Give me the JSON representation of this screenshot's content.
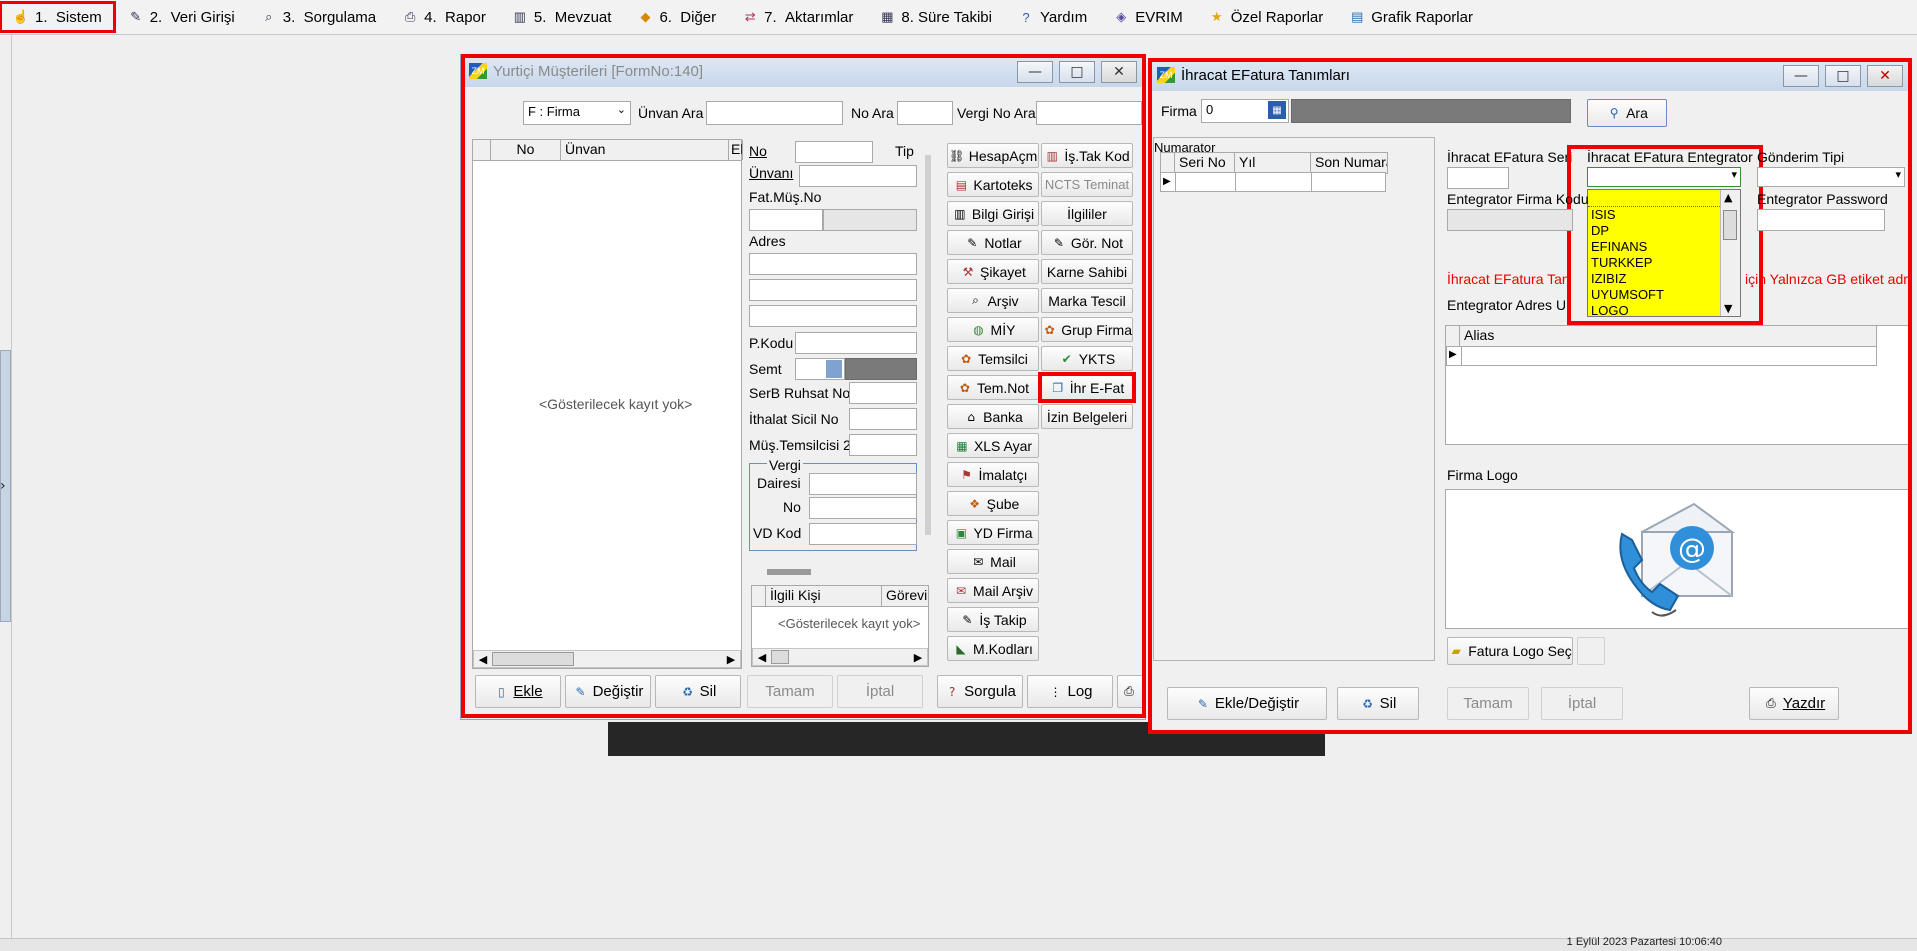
{
  "menu": [
    {
      "num": "1.",
      "label": "Sistem",
      "icon": "hand-icon"
    },
    {
      "num": "2.",
      "label": "Veri Girişi",
      "icon": "edit-icon"
    },
    {
      "num": "3.",
      "label": "Sorgulama",
      "icon": "query-icon"
    },
    {
      "num": "4.",
      "label": "Rapor",
      "icon": "printer-icon"
    },
    {
      "num": "5.",
      "label": "Mevzuat",
      "icon": "books-icon"
    },
    {
      "num": "6.",
      "label": "Diğer",
      "icon": "shapes-icon"
    },
    {
      "num": "7.",
      "label": "Aktarımlar",
      "icon": "transfer-icon"
    },
    {
      "num": "",
      "label": "8. Süre Takibi",
      "icon": "calendar-icon"
    },
    {
      "num": "",
      "label": "Yardım",
      "icon": "help-icon"
    },
    {
      "num": "",
      "label": "EVRIM",
      "icon": "evrim-icon"
    },
    {
      "num": "",
      "label": "Özel Raporlar",
      "icon": "star-icon"
    },
    {
      "num": "",
      "label": "Grafik Raporlar",
      "icon": "chart-icon"
    }
  ],
  "status": {
    "datetime": "1 Eylül 2023 Pazartesi 10:06:40"
  },
  "win1": {
    "title": "Yurtiçi Müşterileri [FormNo:140]",
    "firma_select": "F : Firma",
    "unvan_ara": "Ünvan Ara",
    "no_ara": "No Ara",
    "vergi_no_ara": "Vergi No Ara",
    "grid_cols": [
      "No",
      "Ünvan",
      "Ek"
    ],
    "empty": "<Gösterilecek kayıt yok>",
    "fields": {
      "no": "No",
      "tip": "Tip",
      "unvani": "Ünvanı",
      "fatmus": "Fat.Müş.No",
      "adres": "Adres",
      "pkodu": "P.Kodu",
      "semt": "Semt",
      "serb": "SerB Ruhsat No",
      "ithalat": "İthalat Sicil No",
      "mustem": "Müş.Temsilcisi 2",
      "vergi": "Vergi",
      "dairesi": "Dairesi",
      "vno": "No",
      "vdkod": "VD Kod"
    },
    "contact_cols": [
      "İlgili Kişi",
      "Görevi"
    ],
    "contact_empty": "<Gösterilecek kayıt yok>",
    "side_buttons_left": [
      "HesapAçm",
      "Kartoteks",
      "Bilgi Girişi",
      "Notlar",
      "Şikayet",
      "Arşiv",
      "MİY",
      "Temsilci",
      "Tem.Not",
      "Banka",
      "XLS Ayar",
      "İmalatçı",
      "Şube",
      "YD Firma",
      "Mail",
      "Mail Arşiv",
      "İş Takip",
      "M.Kodları"
    ],
    "side_buttons_right": [
      "İş.Tak Kod",
      "NCTS Teminat",
      "İlgililer",
      "Gör. Not",
      "Karne Sahibi",
      "Marka Tescil",
      "Grup Firma",
      "YKTS",
      "İhr E-Fat",
      "İzin Belgeleri"
    ],
    "bottom": {
      "ekle": "Ekle",
      "degistir": "Değiştir",
      "sil": "Sil",
      "tamam": "Tamam",
      "iptal": "İptal",
      "sorgula": "Sorgula",
      "log": "Log"
    }
  },
  "win2": {
    "title": "İhracat EFatura Tanımları",
    "firma_label": "Firma",
    "firma_value": "0",
    "ara": "Ara",
    "numarator": "Numarator",
    "num_cols": [
      "Seri No",
      "Yıl",
      "Son Numara"
    ],
    "seri_label": "İhracat EFatura Seri",
    "entegrator_label": "İhracat EFatura Entegrator",
    "gonderim_label": "Gönderim Tipi",
    "firma_kodu_label": "Entegrator Firma Kodu",
    "password_label": "Entegrator Password",
    "dropdown_options": [
      "",
      "ISIS",
      "DP",
      "EFINANS",
      "TURKKEP",
      "IZIBIZ",
      "UYUMSOFT",
      "LOGO"
    ],
    "red_left": "İhracat EFatura Tanımla",
    "red_right": "için Yalnızca GB etiket adre",
    "adres_url_label": "Entegrator Adres Url",
    "alias_col": "Alias",
    "firma_logo_label": "Firma Logo",
    "logo_sec": "Fatura Logo Seç",
    "bottom": {
      "ekle": "Ekle/Değiştir",
      "sil": "Sil",
      "tamam": "Tamam",
      "iptal": "İptal",
      "yazdir": "Yazdır"
    }
  }
}
